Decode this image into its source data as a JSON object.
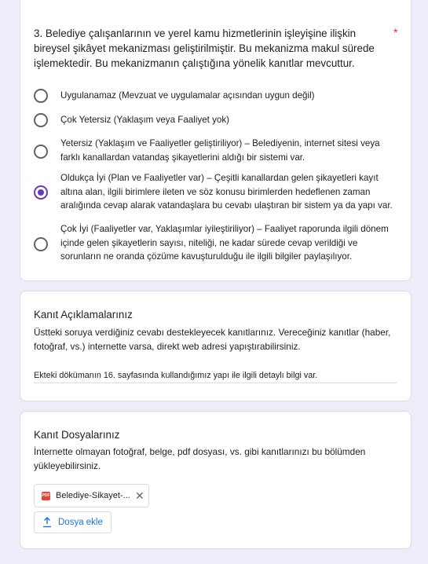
{
  "question": {
    "title": "3. Belediye çalışanlarının ve yerel kamu hizmetlerinin işleyişine ilişkin bireysel şikâyet mekanizması geliştirilmiştir. Bu mekanizma makul sürede işlemektedir. Bu mekanizmanın çalıştığına yönelik kanıtlar mevcuttur.",
    "required_mark": "*",
    "options": [
      {
        "label": "Uygulanamaz (Mevzuat ve uygulamalar açısından uygun değil)",
        "selected": false
      },
      {
        "label": "Çok Yetersiz (Yaklaşım veya Faaliyet yok)",
        "selected": false
      },
      {
        "label": "Yetersiz (Yaklaşım ve Faaliyetler geliştiriliyor) – Belediyenin, internet sitesi veya farklı kanallardan vatandaş şikayetlerini aldığı bir sistemi var.",
        "selected": false
      },
      {
        "label": "Oldukça İyi (Plan ve Faaliyetler var) – Çeşitli kanallardan gelen şikayetleri kayıt altına alan, ilgili birimlere ileten ve söz konusu birimlerden hedeflenen zaman aralığında cevap alarak vatandaşlara bu cevabı ulaştıran bir sistem ya da yapı var.",
        "selected": true
      },
      {
        "label": "Çok İyi (Faaliyetler var, Yaklaşımlar iyileştiriliyor) – Faaliyet raporunda ilgili dönem içinde gelen şikayetlerin sayısı, niteliği, ne kadar sürede cevap verildiği ve sorunların ne oranda çözüme kavuşturulduğu ile ilgili bilgiler paylaşılıyor.",
        "selected": false
      }
    ]
  },
  "explanation": {
    "title": "Kanıt Açıklamalarınız",
    "description": "Üstteki soruya verdiğiniz cevabı destekleyecek kanıtlarınız. Vereceğiniz kanıtlar (haber, fotoğraf, vs.) internette varsa, direkt web adresi yapıştırabilirsiniz.",
    "answer": "Ekteki dökümanın 16. sayfasında kullandığımız yapı ile ilgili detaylı bilgi var."
  },
  "files": {
    "title": "Kanıt Dosyalarınız",
    "description": "İnternette olmayan fotoğraf, belge, pdf dosyası, vs. gibi kanıtlarınızı bu bölümden yükleyebilirsiniz.",
    "file_name": "Belediye-Sikayet-...",
    "file_icon_text": "PDF",
    "close_symbol": "✕",
    "add_button": "Dosya ekle"
  },
  "colors": {
    "background": "#f0ebf8",
    "accent": "#673ab7",
    "required": "#d93025",
    "link": "#1a73e8",
    "pdf": "#ea4335"
  },
  "icons": [
    "radio-button-icon",
    "pdf-file-icon",
    "close-icon",
    "upload-icon"
  ]
}
